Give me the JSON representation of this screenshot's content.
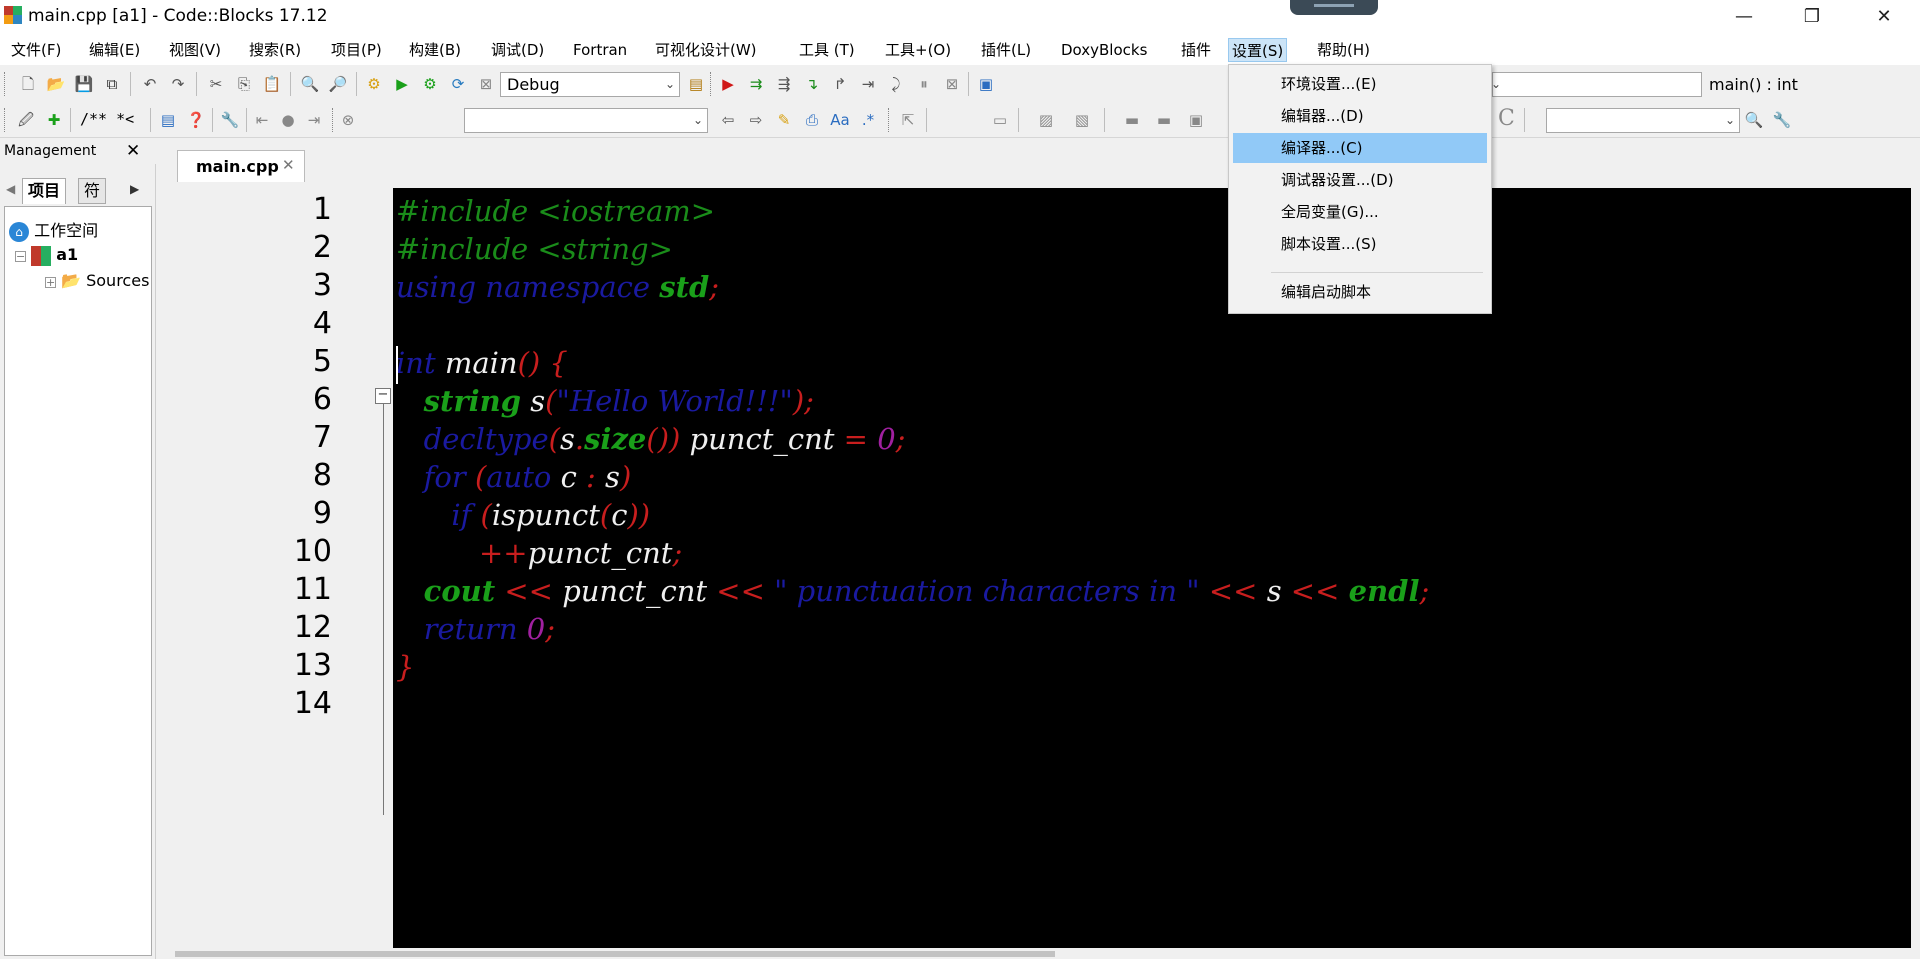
{
  "window": {
    "title": "main.cpp [a1] - Code::Blocks 17.12",
    "minimize": "—",
    "restore": "❐",
    "close": "✕"
  },
  "menubar": {
    "items": [
      "文件(F)",
      "编辑(E)",
      "视图(V)",
      "搜索(R)",
      "项目(P)",
      "构建(B)",
      "调试(D)",
      "Fortran",
      "可视化设计(W)",
      "工具 (T)",
      "工具+(O)",
      "插件(L)",
      "DoxyBlocks",
      "插件",
      "设置(S)",
      "帮助(H)"
    ],
    "active": "设置(S)"
  },
  "toolbar": {
    "build_target": "Debug",
    "symbol_combo": "main() : int",
    "comment_label": "/** *<",
    "search_combo_value": "",
    "find_combo_value": "",
    "c_label": "C"
  },
  "management": {
    "title": "Management",
    "close": "✕",
    "tab_project": "项目",
    "tab_symbols": "符",
    "workspace": "工作空间",
    "project": "a1",
    "sources": "Sources"
  },
  "editor": {
    "tab_label": "main.cpp",
    "tab_close": "✕",
    "line_numbers": [
      "1",
      "2",
      "3",
      "4",
      "5",
      "6",
      "7",
      "8",
      "9",
      "10",
      "11",
      "12",
      "13",
      "14"
    ]
  },
  "settings_menu": {
    "items": [
      "环境设置...(E)",
      "编辑器...(D)",
      "编译器...(C)",
      "调试器设置...(D)",
      "全局变量(G)...",
      "脚本设置...(S)",
      "编辑启动脚本"
    ],
    "highlighted": "编译器...(C)"
  },
  "colors": {
    "editor_bg": "#000000",
    "keyword": "#1a1aa0",
    "preprocessor": "#1a8c1a",
    "operator": "#c81e1e",
    "number": "#a020a0",
    "menu_highlight": "#91c9f7"
  }
}
